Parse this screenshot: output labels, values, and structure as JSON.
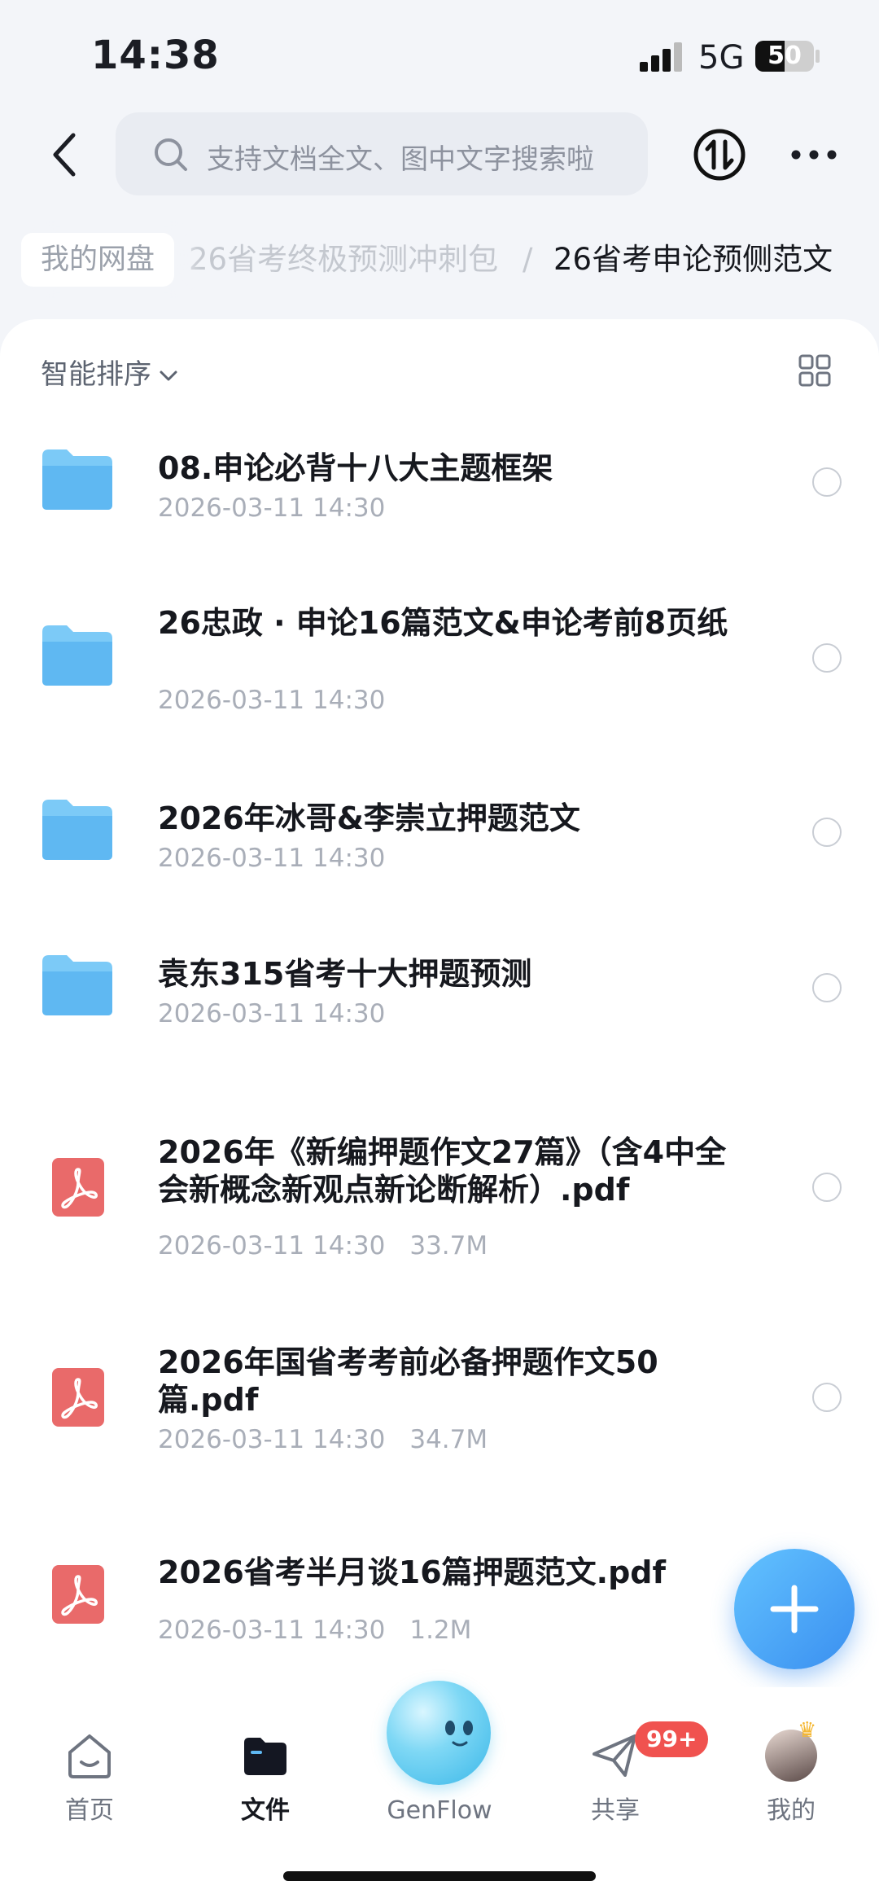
{
  "status_bar": {
    "time": "14:38",
    "network": "5G",
    "battery": "50",
    "battery_level": 0.5
  },
  "header": {
    "search_placeholder": "支持文档全文、图中文字搜索啦"
  },
  "breadcrumb": {
    "root": "我的网盘",
    "middle": "26省考终极预测冲刺包",
    "separator": "/",
    "current": "26省考申论预侧范文"
  },
  "toolbar": {
    "sort_label": "智能排序"
  },
  "files": [
    {
      "type": "folder",
      "name": "08.申论必背十八大主题框架",
      "date": "2026-03-11 14:30",
      "size": ""
    },
    {
      "type": "folder",
      "name": "26忠政 · 申论16篇范文&申论考前8页纸",
      "date": "2026-03-11 14:30",
      "size": ""
    },
    {
      "type": "folder",
      "name": "2026年冰哥&李崇立押题范文",
      "date": "2026-03-11 14:30",
      "size": ""
    },
    {
      "type": "folder",
      "name": "袁东315省考十大押题预测",
      "date": "2026-03-11 14:30",
      "size": ""
    },
    {
      "type": "pdf",
      "name": "2026年《新编押题作文27篇》（含4中全会新概念新观点新论断解析）.pdf",
      "date": "2026-03-11 14:30",
      "size": "33.7M"
    },
    {
      "type": "pdf",
      "name": "2026年国省考考前必备押题作文50篇.pdf",
      "date": "2026-03-11 14:30",
      "size": "34.7M"
    },
    {
      "type": "pdf",
      "name": "2026省考半月谈16篇押题范文.pdf",
      "date": "2026-03-11 14:30",
      "size": "1.2M"
    }
  ],
  "nav": {
    "home": "首页",
    "files": "文件",
    "genflow": "GenFlow",
    "share": "共享",
    "share_badge": "99+",
    "me": "我的"
  },
  "colors": {
    "accent": "#3a8ff0",
    "folder": "#5fb8f2",
    "pdf": "#e96a6a",
    "badge": "#f0524f"
  }
}
